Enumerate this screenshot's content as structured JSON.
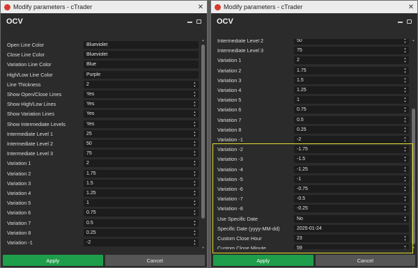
{
  "colors": {
    "accent": "#1e9e4a",
    "highlight": "#e6e22b",
    "brand_logo": "#d83a2e"
  },
  "window1": {
    "title": "Modify parameters - cTrader",
    "header": "OCV",
    "rows": [
      {
        "label": "Open Line Color",
        "value": "Blueviolet",
        "spinner": false
      },
      {
        "label": "Close Line Color",
        "value": "Blueviolet",
        "spinner": false
      },
      {
        "label": "Variation Line Color",
        "value": "Blue",
        "spinner": false
      },
      {
        "label": "High/Low Line Color",
        "value": "Purple",
        "spinner": false
      },
      {
        "label": "Line Thickness",
        "value": "2",
        "spinner": true
      },
      {
        "label": "Show Open/Close Lines",
        "value": "Yes",
        "spinner": true
      },
      {
        "label": "Show High/Low Lines",
        "value": "Yes",
        "spinner": true
      },
      {
        "label": "Show Variation Lines",
        "value": "Yes",
        "spinner": true
      },
      {
        "label": "Show Intermediate Levels",
        "value": "Yes",
        "spinner": true
      },
      {
        "label": "Intermediate Level 1",
        "value": "25",
        "spinner": true
      },
      {
        "label": "Intermediate Level 2",
        "value": "50",
        "spinner": true
      },
      {
        "label": "Intermediate Level 3",
        "value": "75",
        "spinner": true
      },
      {
        "label": "Variation 1",
        "value": "2",
        "spinner": true
      },
      {
        "label": "Variation 2",
        "value": "1.75",
        "spinner": true
      },
      {
        "label": "Variation 3",
        "value": "1.5",
        "spinner": true
      },
      {
        "label": "Variation 4",
        "value": "1.25",
        "spinner": true
      },
      {
        "label": "Variation 5",
        "value": "1",
        "spinner": true
      },
      {
        "label": "Variation 6",
        "value": "0.75",
        "spinner": true
      },
      {
        "label": "Variation 7",
        "value": "0.5",
        "spinner": true
      },
      {
        "label": "Variation 8",
        "value": "0.25",
        "spinner": true
      },
      {
        "label": "Variation -1",
        "value": "-2",
        "spinner": true
      }
    ],
    "apply_label": "Apply",
    "cancel_label": "Cancel"
  },
  "window2": {
    "title": "Modify parameters - cTrader",
    "header": "OCV",
    "rows": [
      {
        "label": "Intermediate Level 2",
        "value": "50",
        "spinner": true
      },
      {
        "label": "Intermediate Level 3",
        "value": "75",
        "spinner": true
      },
      {
        "label": "Variation 1",
        "value": "2",
        "spinner": true
      },
      {
        "label": "Variation 2",
        "value": "1.75",
        "spinner": true
      },
      {
        "label": "Variation 3",
        "value": "1.5",
        "spinner": true
      },
      {
        "label": "Variation 4",
        "value": "1.25",
        "spinner": true
      },
      {
        "label": "Variation 5",
        "value": "1",
        "spinner": true
      },
      {
        "label": "Variation 6",
        "value": "0.75",
        "spinner": true
      },
      {
        "label": "Variation 7",
        "value": "0.5",
        "spinner": true
      },
      {
        "label": "Variation 8",
        "value": "0.25",
        "spinner": true
      },
      {
        "label": "Variation -1",
        "value": "-2",
        "spinner": true
      },
      {
        "label": "Variation -2",
        "value": "-1.75",
        "spinner": true
      },
      {
        "label": "Variation -3",
        "value": "-1.5",
        "spinner": true
      },
      {
        "label": "Variation -4",
        "value": "-1.25",
        "spinner": true
      },
      {
        "label": "Variation -5",
        "value": "-1",
        "spinner": true
      },
      {
        "label": "Variation -6",
        "value": "-0.75",
        "spinner": true
      },
      {
        "label": "Variation -7",
        "value": "-0.5",
        "spinner": true
      },
      {
        "label": "Variation -8",
        "value": "-0.25",
        "spinner": true
      },
      {
        "label": "Use Specific Date",
        "value": "No",
        "spinner": true
      },
      {
        "label": "Specific Date (yyyy-MM-dd)",
        "value": "2025-01-24",
        "spinner": false
      },
      {
        "label": "Custom Close Hour",
        "value": "23",
        "spinner": true
      },
      {
        "label": "Custom Close Minute",
        "value": "59",
        "spinner": true
      }
    ],
    "apply_label": "Apply",
    "cancel_label": "Cancel"
  }
}
